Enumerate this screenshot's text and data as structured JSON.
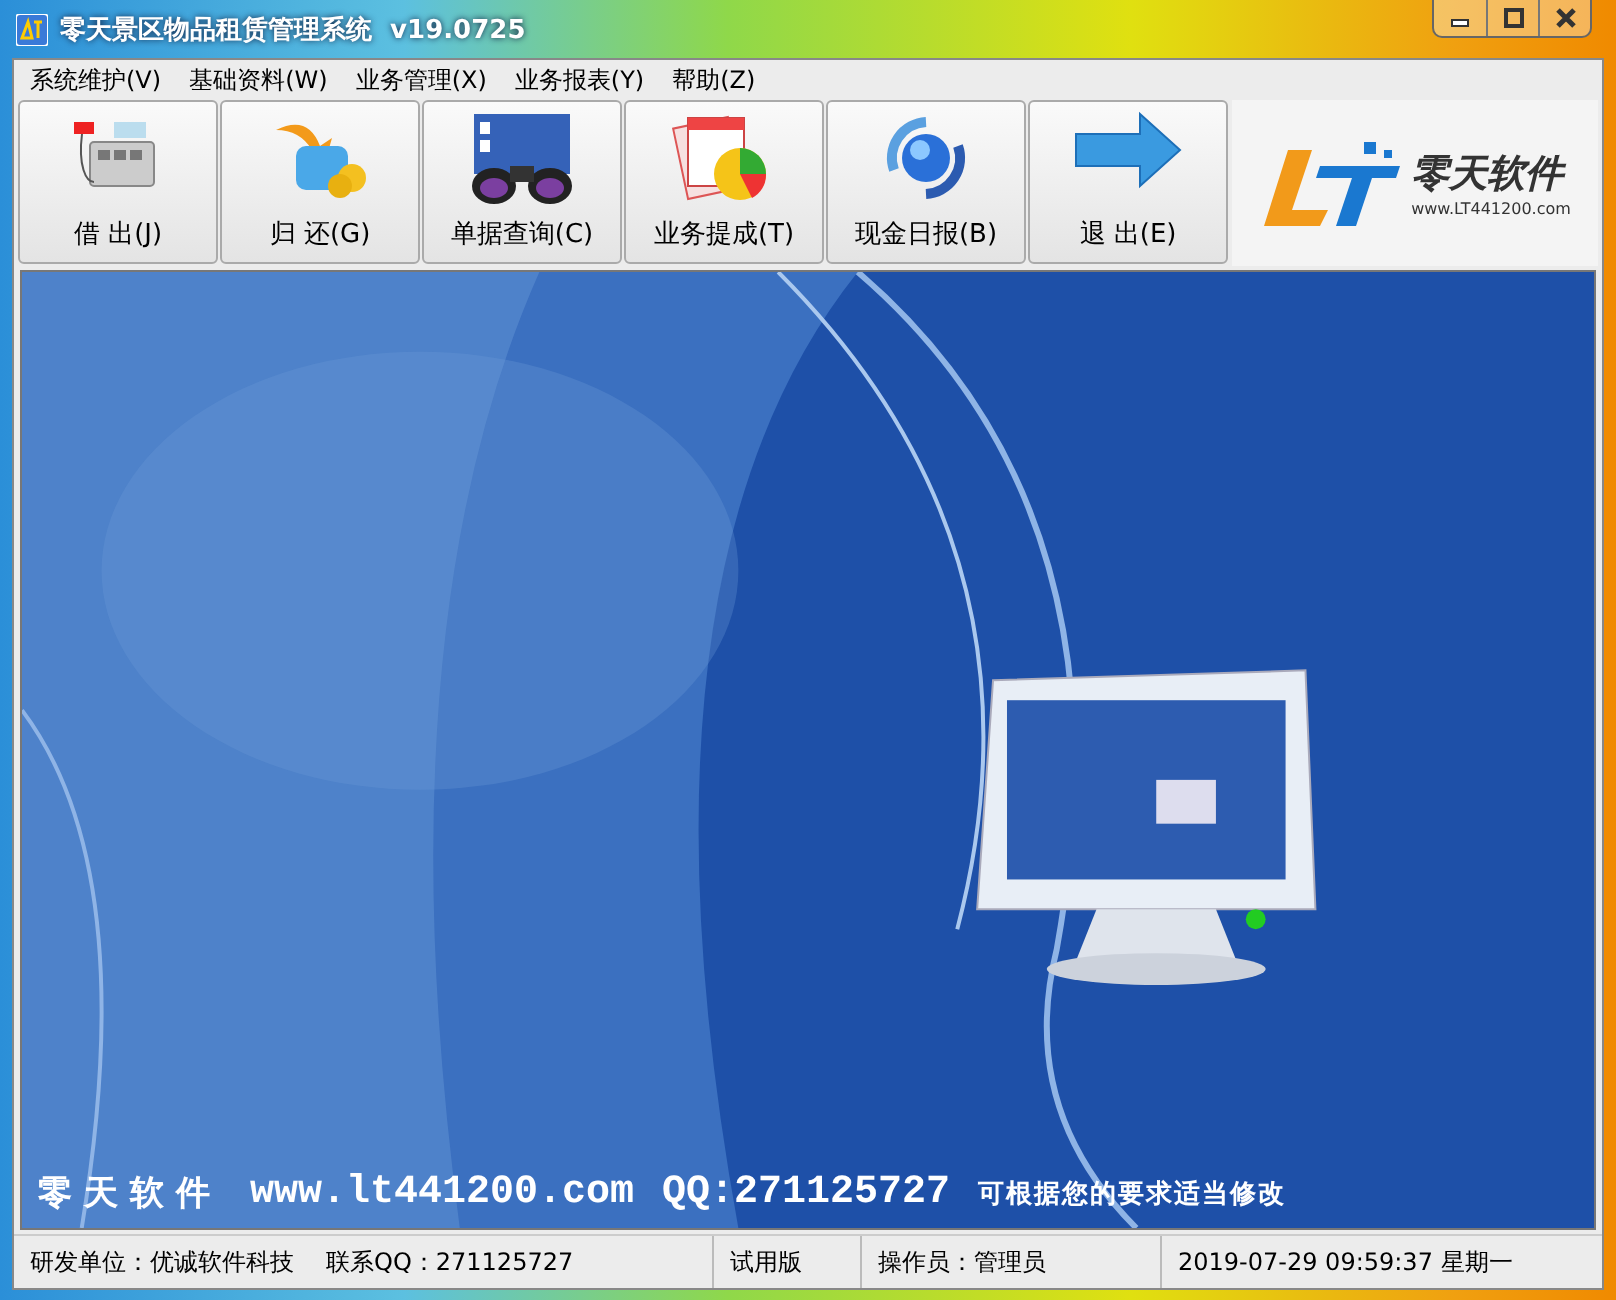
{
  "window": {
    "title": "零天景区物品租赁管理系统  v19.0725"
  },
  "menu": [
    "系统维护(V)",
    "基础资料(W)",
    "业务管理(X)",
    "业务报表(Y)",
    "帮助(Z)"
  ],
  "toolbar": {
    "buttons": [
      {
        "label": "借 出(J)",
        "kind": "register"
      },
      {
        "label": "归 还(G)",
        "kind": "return"
      },
      {
        "label": "单据查询(C)",
        "kind": "binoculars"
      },
      {
        "label": "业务提成(T)",
        "kind": "report"
      },
      {
        "label": "现金日报(B)",
        "kind": "globe"
      },
      {
        "label": "退 出(E)",
        "kind": "arrow"
      }
    ],
    "logo": {
      "name": "零天软件",
      "url": "www.LT441200.com"
    }
  },
  "banner": {
    "brand": "零天软件",
    "site": "www.lt441200.com",
    "qq": "QQ:271125727",
    "note": "可根据您的要求适当修改"
  },
  "status_bar": [
    {
      "texts": [
        "研发单位：优诚软件科技",
        "联系QQ：271125727"
      ]
    },
    {
      "texts": [
        "试用版"
      ]
    },
    {
      "texts": [
        "操作员：管理员"
      ]
    },
    {
      "texts": [
        "2019-07-29 09:59:37 星期一"
      ]
    }
  ]
}
